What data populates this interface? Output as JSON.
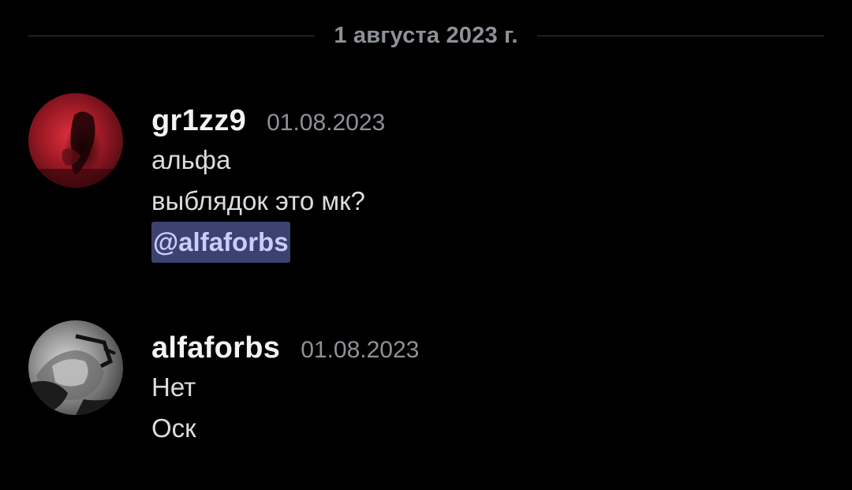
{
  "divider": {
    "date_label": "1 августа 2023 г."
  },
  "messages": [
    {
      "avatar_icon": "user-avatar-red-photo",
      "username": "gr1zz9",
      "timestamp": "01.08.2023",
      "lines": [
        "альфа",
        "выблядок это мк?"
      ],
      "mention": "@alfaforbs"
    },
    {
      "avatar_icon": "user-avatar-grayscale-photo",
      "username": "alfaforbs",
      "timestamp": "01.08.2023",
      "lines": [
        "Нет",
        "Оск"
      ]
    }
  ],
  "colors": {
    "background": "#000000",
    "username": "#f2f3f5",
    "text": "#dcdde1",
    "muted": "#8e9197",
    "mention_bg": "#3c4270",
    "mention_text": "#c9cdfb"
  }
}
